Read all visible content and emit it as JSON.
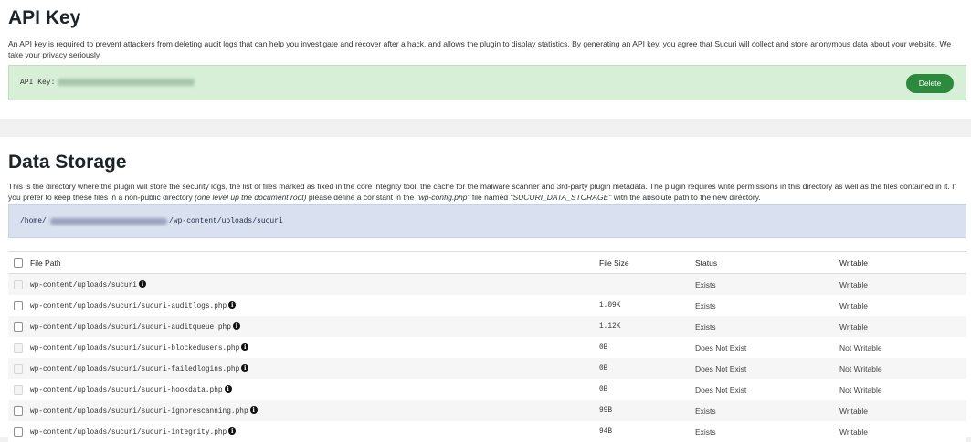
{
  "api_key": {
    "title": "API Key",
    "description": "An API key is required to prevent attackers from deleting audit logs that can help you investigate and recover after a hack, and allows the plugin to display statistics. By generating an API key, you agree that Sucuri will collect and store anonymous data about your website. We take your privacy seriously.",
    "label": "API Key:",
    "delete_label": "Delete"
  },
  "data_storage": {
    "title": "Data Storage",
    "description_parts": [
      "This is the directory where the plugin will store the security logs, the list of files marked as fixed in the core integrity tool, the cache for the malware scanner and 3rd-party plugin metadata. The plugin requires write permissions in this directory as well as the files contained in it. If you prefer to keep these files in a non-public directory ",
      "(one level up the document root)",
      " please define a constant in the ",
      "\"wp-config.php\"",
      " file named ",
      "\"SUCURI_DATA_STORAGE\"",
      " with the absolute path to the new directory."
    ],
    "path_prefix": "/home/",
    "path_suffix": "/wp-content/uploads/sucuri"
  },
  "table": {
    "headers": {
      "file_path": "File Path",
      "file_size": "File Size",
      "status": "Status",
      "writable": "Writable"
    },
    "rows": [
      {
        "path": "wp-content/uploads/sucuri",
        "size": "",
        "status": "Exists",
        "writable": "Writable",
        "checkbox_enabled": false
      },
      {
        "path": "wp-content/uploads/sucuri/sucuri-auditlogs.php",
        "size": "1.09K",
        "status": "Exists",
        "writable": "Writable",
        "checkbox_enabled": true
      },
      {
        "path": "wp-content/uploads/sucuri/sucuri-auditqueue.php",
        "size": "1.12K",
        "status": "Exists",
        "writable": "Writable",
        "checkbox_enabled": true
      },
      {
        "path": "wp-content/uploads/sucuri/sucuri-blockedusers.php",
        "size": "0B",
        "status": "Does Not Exist",
        "writable": "Not Writable",
        "checkbox_enabled": false
      },
      {
        "path": "wp-content/uploads/sucuri/sucuri-failedlogins.php",
        "size": "0B",
        "status": "Does Not Exist",
        "writable": "Not Writable",
        "checkbox_enabled": false
      },
      {
        "path": "wp-content/uploads/sucuri/sucuri-hookdata.php",
        "size": "0B",
        "status": "Does Not Exist",
        "writable": "Not Writable",
        "checkbox_enabled": false
      },
      {
        "path": "wp-content/uploads/sucuri/sucuri-ignorescanning.php",
        "size": "99B",
        "status": "Exists",
        "writable": "Writable",
        "checkbox_enabled": true
      },
      {
        "path": "wp-content/uploads/sucuri/sucuri-integrity.php",
        "size": "94B",
        "status": "Exists",
        "writable": "Writable",
        "checkbox_enabled": true
      }
    ]
  },
  "icons": {
    "info": "info-circle-icon"
  },
  "colors": {
    "accent_green": "#2b8a3e",
    "success_bg": "#d7efd6",
    "info_bg": "#d9e0ef"
  }
}
